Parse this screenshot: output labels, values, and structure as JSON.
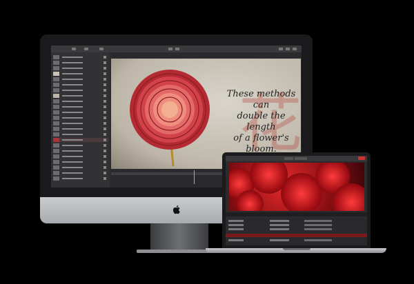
{
  "imac": {
    "quote_lines": [
      "These methods can",
      "double the length",
      "of a flower's bloom."
    ],
    "kanji": "花"
  },
  "colors": {
    "background": "#000000",
    "accent_red": "#c8262a",
    "playhead": "#e8a13b"
  },
  "icons": {
    "brand": "apple-logo-icon"
  }
}
